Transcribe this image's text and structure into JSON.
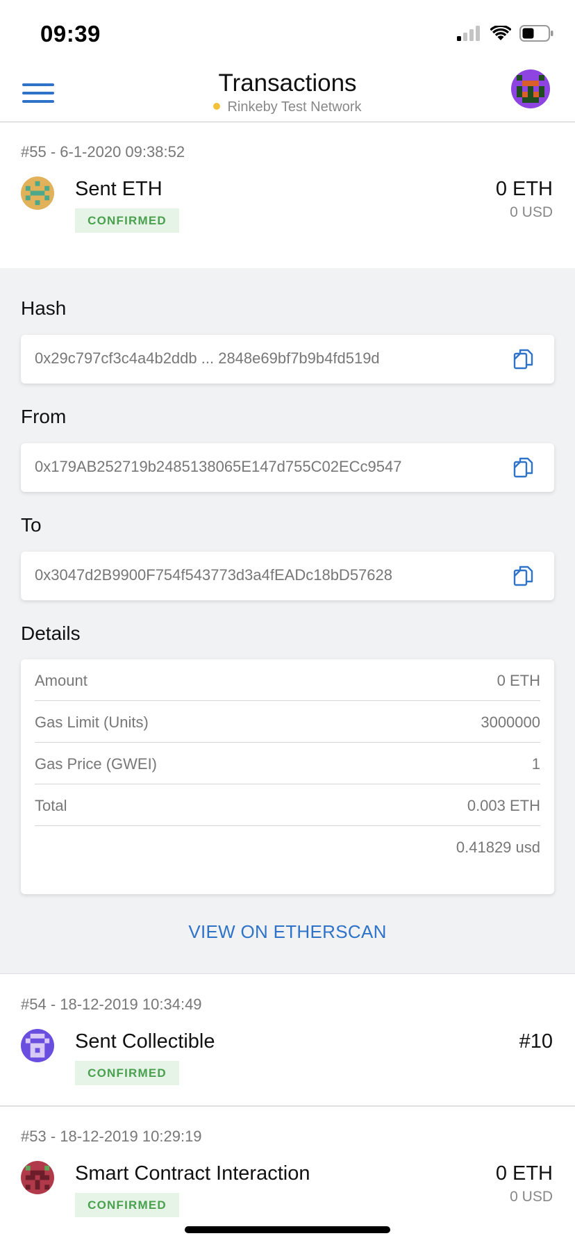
{
  "status_bar": {
    "time": "09:39"
  },
  "header": {
    "title": "Transactions",
    "network": "Rinkeby Test Network",
    "network_dot_color": "#f2c13a",
    "menu_icon": "hamburger-menu-icon",
    "account_icon": "account-identicon"
  },
  "transactions": [
    {
      "meta": "#55  - 6-1-2020 09:38:52",
      "title": "Sent ETH",
      "status": "CONFIRMED",
      "amount": "0 ETH",
      "fiat": "0 USD",
      "icon": "identicon-tan"
    },
    {
      "meta": "#54  - 18-12-2019 10:34:49",
      "title": "Sent Collectible",
      "status": "CONFIRMED",
      "amount": "#10",
      "icon": "identicon-purple"
    },
    {
      "meta": "#53  - 18-12-2019 10:29:19",
      "title": "Smart Contract Interaction",
      "status": "CONFIRMED",
      "amount": "0 ETH",
      "fiat": "0 USD",
      "icon": "identicon-maroon"
    }
  ],
  "detail": {
    "hash_label": "Hash",
    "hash_value": "0x29c797cf3c4a4b2ddb ... 2848e69bf7b9b4fd519d",
    "from_label": "From",
    "from_value": "0x179AB252719b2485138065E147d755C02ECc9547",
    "to_label": "To",
    "to_value": "0x3047d2B9900F754f543773d3a4fEADc18bD57628",
    "details_label": "Details",
    "rows": [
      {
        "label": "Amount",
        "value": "0 ETH"
      },
      {
        "label": "Gas Limit (Units)",
        "value": "3000000"
      },
      {
        "label": "Gas Price (GWEI)",
        "value": "1"
      },
      {
        "label": "Total",
        "value": "0.003 ETH"
      },
      {
        "label": "",
        "value": "0.41829 usd"
      }
    ],
    "etherscan_link": "VIEW ON ETHERSCAN"
  },
  "colors": {
    "accent": "#2f73c9",
    "confirmed_bg": "#e6f4e7",
    "confirmed_text": "#4aa04f",
    "panel_bg": "#f1f2f4"
  }
}
